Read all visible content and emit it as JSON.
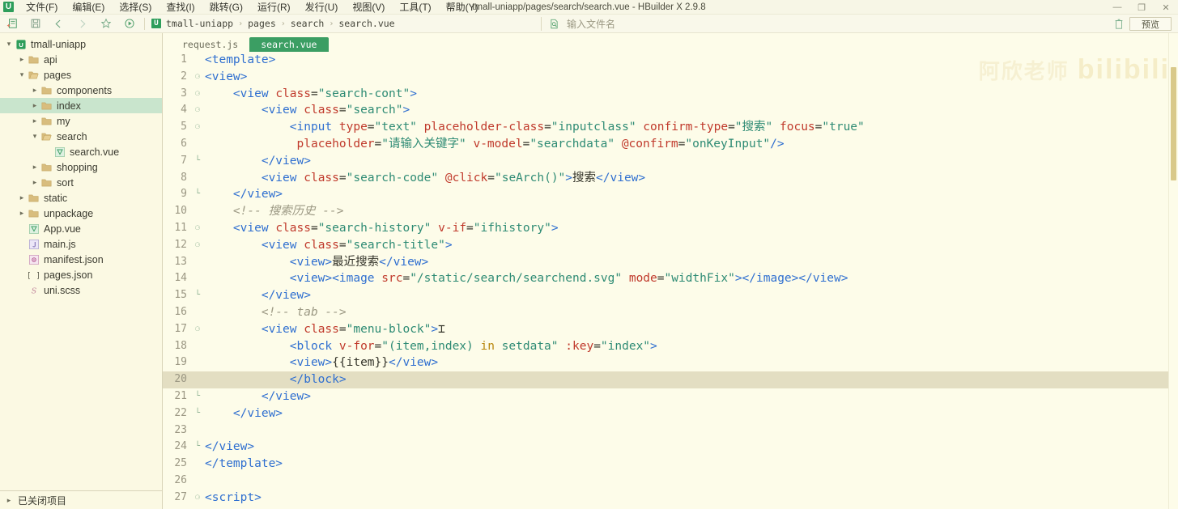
{
  "window": {
    "title": "tmall-uniapp/pages/search/search.vue - HBuilder X 2.9.8",
    "logo": "U",
    "minimize_label": "—",
    "restore_label": "❐",
    "close_label": "✕"
  },
  "menubar": {
    "items": [
      {
        "label": "文件(F)",
        "name": "menu-file"
      },
      {
        "label": "编辑(E)",
        "name": "menu-edit"
      },
      {
        "label": "选择(S)",
        "name": "menu-select"
      },
      {
        "label": "查找(I)",
        "name": "menu-find"
      },
      {
        "label": "跳转(G)",
        "name": "menu-goto"
      },
      {
        "label": "运行(R)",
        "name": "menu-run"
      },
      {
        "label": "发行(U)",
        "name": "menu-publish"
      },
      {
        "label": "视图(V)",
        "name": "menu-view"
      },
      {
        "label": "工具(T)",
        "name": "menu-tools"
      },
      {
        "label": "帮助(Y)",
        "name": "menu-help"
      }
    ]
  },
  "toolbar": {
    "icons": [
      {
        "name": "new-file-icon"
      },
      {
        "name": "save-icon"
      },
      {
        "name": "back-arrow-icon"
      },
      {
        "name": "forward-arrow-icon"
      },
      {
        "name": "favorite-star-icon"
      },
      {
        "name": "run-play-icon"
      }
    ],
    "breadcrumb_logo": "U",
    "breadcrumb": [
      "tmall-uniapp",
      "pages",
      "search",
      "search.vue"
    ],
    "breadcrumb_separator": "›",
    "filename_placeholder": "输入文件名",
    "preview_label": "预览"
  },
  "sidebar": {
    "tree": [
      {
        "label": "tmall-uniapp",
        "indent": 0,
        "twisty": "down",
        "icon": "project-icon",
        "selected": false
      },
      {
        "label": "api",
        "indent": 1,
        "twisty": "right",
        "icon": "folder-icon",
        "selected": false
      },
      {
        "label": "pages",
        "indent": 1,
        "twisty": "down",
        "icon": "folder-open-icon",
        "selected": false
      },
      {
        "label": "components",
        "indent": 2,
        "twisty": "right",
        "icon": "folder-icon",
        "selected": false
      },
      {
        "label": "index",
        "indent": 2,
        "twisty": "right",
        "icon": "folder-icon",
        "selected": true
      },
      {
        "label": "my",
        "indent": 2,
        "twisty": "right",
        "icon": "folder-icon",
        "selected": false
      },
      {
        "label": "search",
        "indent": 2,
        "twisty": "down",
        "icon": "folder-open-icon",
        "selected": false
      },
      {
        "label": "search.vue",
        "indent": 3,
        "twisty": "none",
        "icon": "vue-file-icon",
        "selected": false
      },
      {
        "label": "shopping",
        "indent": 2,
        "twisty": "right",
        "icon": "folder-icon",
        "selected": false
      },
      {
        "label": "sort",
        "indent": 2,
        "twisty": "right",
        "icon": "folder-icon",
        "selected": false
      },
      {
        "label": "static",
        "indent": 1,
        "twisty": "right",
        "icon": "folder-icon",
        "selected": false
      },
      {
        "label": "unpackage",
        "indent": 1,
        "twisty": "right",
        "icon": "folder-icon",
        "selected": false
      },
      {
        "label": "App.vue",
        "indent": 1,
        "twisty": "none",
        "icon": "vue-file-icon",
        "selected": false
      },
      {
        "label": "main.js",
        "indent": 1,
        "twisty": "none",
        "icon": "js-file-icon",
        "selected": false
      },
      {
        "label": "manifest.json",
        "indent": 1,
        "twisty": "none",
        "icon": "json-file-icon",
        "selected": false
      },
      {
        "label": "pages.json",
        "indent": 1,
        "twisty": "none",
        "icon": "brackets-file-icon",
        "selected": false
      },
      {
        "label": "uni.scss",
        "indent": 1,
        "twisty": "none",
        "icon": "scss-file-icon",
        "selected": false
      }
    ],
    "closed_projects_label": "已关闭项目"
  },
  "editor": {
    "tabs": [
      {
        "label": "request.js",
        "active": false
      },
      {
        "label": "search.vue",
        "active": true
      }
    ],
    "watermark_cn": "阿欣老师",
    "watermark_en": "bilibili",
    "active_line": 20,
    "lines": [
      {
        "n": 1,
        "fold": "",
        "indent": 0,
        "tokens": [
          {
            "c": "t-tag",
            "t": "<template>"
          }
        ]
      },
      {
        "n": 2,
        "fold": "-",
        "indent": 0,
        "tokens": [
          {
            "c": "t-tag",
            "t": "<view>"
          }
        ]
      },
      {
        "n": 3,
        "fold": "-",
        "indent": 1,
        "tokens": [
          {
            "c": "t-tag",
            "t": "<view "
          },
          {
            "c": "t-attr",
            "t": "class"
          },
          {
            "c": "t-plain",
            "t": "="
          },
          {
            "c": "t-str",
            "t": "\"search-cont\""
          },
          {
            "c": "t-tag",
            "t": ">"
          }
        ]
      },
      {
        "n": 4,
        "fold": "-",
        "indent": 2,
        "tokens": [
          {
            "c": "t-tag",
            "t": "<view "
          },
          {
            "c": "t-attr",
            "t": "class"
          },
          {
            "c": "t-plain",
            "t": "="
          },
          {
            "c": "t-str",
            "t": "\"search\""
          },
          {
            "c": "t-tag",
            "t": ">"
          }
        ]
      },
      {
        "n": 5,
        "fold": "-",
        "indent": 3,
        "tokens": [
          {
            "c": "t-tag",
            "t": "<input "
          },
          {
            "c": "t-attr",
            "t": "type"
          },
          {
            "c": "t-plain",
            "t": "="
          },
          {
            "c": "t-str",
            "t": "\"text\""
          },
          {
            "c": "t-plain",
            "t": " "
          },
          {
            "c": "t-attr",
            "t": "placeholder-class"
          },
          {
            "c": "t-plain",
            "t": "="
          },
          {
            "c": "t-str",
            "t": "\"inputclass\""
          },
          {
            "c": "t-plain",
            "t": " "
          },
          {
            "c": "t-attr",
            "t": "confirm-type"
          },
          {
            "c": "t-plain",
            "t": "="
          },
          {
            "c": "t-str",
            "t": "\"搜索\""
          },
          {
            "c": "t-plain",
            "t": " "
          },
          {
            "c": "t-attr",
            "t": "focus"
          },
          {
            "c": "t-plain",
            "t": "="
          },
          {
            "c": "t-str",
            "t": "\"true\""
          }
        ]
      },
      {
        "n": 6,
        "fold": "",
        "indent": 3,
        "tokens": [
          {
            "c": "t-plain",
            "t": " "
          },
          {
            "c": "t-attr",
            "t": "placeholder"
          },
          {
            "c": "t-plain",
            "t": "="
          },
          {
            "c": "t-str",
            "t": "\"请输入关键字\""
          },
          {
            "c": "t-plain",
            "t": " "
          },
          {
            "c": "t-attr",
            "t": "v-model"
          },
          {
            "c": "t-plain",
            "t": "="
          },
          {
            "c": "t-str",
            "t": "\"searchdata\""
          },
          {
            "c": "t-plain",
            "t": " "
          },
          {
            "c": "t-attr",
            "t": "@confirm"
          },
          {
            "c": "t-plain",
            "t": "="
          },
          {
            "c": "t-str",
            "t": "\"onKeyInput\""
          },
          {
            "c": "t-tag",
            "t": "/>"
          }
        ]
      },
      {
        "n": 7,
        "fold": "|",
        "indent": 2,
        "tokens": [
          {
            "c": "t-tag",
            "t": "</view>"
          }
        ]
      },
      {
        "n": 8,
        "fold": "",
        "indent": 2,
        "tokens": [
          {
            "c": "t-tag",
            "t": "<view "
          },
          {
            "c": "t-attr",
            "t": "class"
          },
          {
            "c": "t-plain",
            "t": "="
          },
          {
            "c": "t-str",
            "t": "\"search-code\""
          },
          {
            "c": "t-plain",
            "t": " "
          },
          {
            "c": "t-attr",
            "t": "@click"
          },
          {
            "c": "t-plain",
            "t": "="
          },
          {
            "c": "t-str",
            "t": "\"seArch()\""
          },
          {
            "c": "t-tag",
            "t": ">"
          },
          {
            "c": "t-plain",
            "t": "搜索"
          },
          {
            "c": "t-tag",
            "t": "</view>"
          }
        ]
      },
      {
        "n": 9,
        "fold": "|",
        "indent": 1,
        "tokens": [
          {
            "c": "t-tag",
            "t": "</view>"
          }
        ]
      },
      {
        "n": 10,
        "fold": "",
        "indent": 1,
        "tokens": [
          {
            "c": "t-comm",
            "t": "<!-- 搜索历史 -->"
          }
        ]
      },
      {
        "n": 11,
        "fold": "-",
        "indent": 1,
        "tokens": [
          {
            "c": "t-tag",
            "t": "<view "
          },
          {
            "c": "t-attr",
            "t": "class"
          },
          {
            "c": "t-plain",
            "t": "="
          },
          {
            "c": "t-str",
            "t": "\"search-history\""
          },
          {
            "c": "t-plain",
            "t": " "
          },
          {
            "c": "t-attr",
            "t": "v-if"
          },
          {
            "c": "t-plain",
            "t": "="
          },
          {
            "c": "t-str",
            "t": "\"ifhistory\""
          },
          {
            "c": "t-tag",
            "t": ">"
          }
        ]
      },
      {
        "n": 12,
        "fold": "-",
        "indent": 2,
        "tokens": [
          {
            "c": "t-tag",
            "t": "<view "
          },
          {
            "c": "t-attr",
            "t": "class"
          },
          {
            "c": "t-plain",
            "t": "="
          },
          {
            "c": "t-str",
            "t": "\"search-title\""
          },
          {
            "c": "t-tag",
            "t": ">"
          }
        ]
      },
      {
        "n": 13,
        "fold": "",
        "indent": 3,
        "tokens": [
          {
            "c": "t-tag",
            "t": "<view>"
          },
          {
            "c": "t-plain",
            "t": "最近搜索"
          },
          {
            "c": "t-tag",
            "t": "</view>"
          }
        ]
      },
      {
        "n": 14,
        "fold": "",
        "indent": 3,
        "tokens": [
          {
            "c": "t-tag",
            "t": "<view><image "
          },
          {
            "c": "t-attr",
            "t": "src"
          },
          {
            "c": "t-plain",
            "t": "="
          },
          {
            "c": "t-str",
            "t": "\"/static/search/searchend.svg\""
          },
          {
            "c": "t-plain",
            "t": " "
          },
          {
            "c": "t-attr",
            "t": "mode"
          },
          {
            "c": "t-plain",
            "t": "="
          },
          {
            "c": "t-str",
            "t": "\"widthFix\""
          },
          {
            "c": "t-tag",
            "t": "></image></view>"
          }
        ]
      },
      {
        "n": 15,
        "fold": "|",
        "indent": 2,
        "tokens": [
          {
            "c": "t-tag",
            "t": "</view>"
          }
        ]
      },
      {
        "n": 16,
        "fold": "",
        "indent": 2,
        "tokens": [
          {
            "c": "t-comm",
            "t": "<!-- tab -->"
          }
        ]
      },
      {
        "n": 17,
        "fold": "-",
        "indent": 2,
        "tokens": [
          {
            "c": "t-tag",
            "t": "<view "
          },
          {
            "c": "t-attr",
            "t": "class"
          },
          {
            "c": "t-plain",
            "t": "="
          },
          {
            "c": "t-str",
            "t": "\"menu-block\""
          },
          {
            "c": "t-tag",
            "t": ">"
          },
          {
            "c": "ibeam",
            "t": "⌶"
          }
        ]
      },
      {
        "n": 18,
        "fold": "",
        "indent": 3,
        "tokens": [
          {
            "c": "t-tag",
            "t": "<block "
          },
          {
            "c": "t-attr",
            "t": "v-for"
          },
          {
            "c": "t-plain",
            "t": "="
          },
          {
            "c": "t-str",
            "t": "\"(item,index) "
          },
          {
            "c": "t-kw",
            "t": "in"
          },
          {
            "c": "t-str",
            "t": " setdata\""
          },
          {
            "c": "t-plain",
            "t": " "
          },
          {
            "c": "t-attr",
            "t": ":key"
          },
          {
            "c": "t-plain",
            "t": "="
          },
          {
            "c": "t-str",
            "t": "\"index\""
          },
          {
            "c": "t-tag",
            "t": ">"
          }
        ]
      },
      {
        "n": 19,
        "fold": "",
        "indent": 3,
        "tokens": [
          {
            "c": "t-tag",
            "t": "<view>"
          },
          {
            "c": "t-mus",
            "t": "{{item}}"
          },
          {
            "c": "t-tag",
            "t": "</view>"
          }
        ]
      },
      {
        "n": 20,
        "fold": "",
        "indent": 3,
        "tokens": [
          {
            "c": "t-tag",
            "t": "</block>"
          }
        ]
      },
      {
        "n": 21,
        "fold": "|",
        "indent": 2,
        "tokens": [
          {
            "c": "t-tag",
            "t": "</view>"
          }
        ]
      },
      {
        "n": 22,
        "fold": "|",
        "indent": 1,
        "tokens": [
          {
            "c": "t-tag",
            "t": "</view>"
          }
        ]
      },
      {
        "n": 23,
        "fold": "",
        "indent": 0,
        "tokens": []
      },
      {
        "n": 24,
        "fold": "|",
        "indent": 0,
        "tokens": [
          {
            "c": "t-tag",
            "t": "</view>"
          }
        ]
      },
      {
        "n": 25,
        "fold": "",
        "indent": 0,
        "tokens": [
          {
            "c": "t-tag",
            "t": "</template>"
          }
        ]
      },
      {
        "n": 26,
        "fold": "",
        "indent": 0,
        "tokens": []
      },
      {
        "n": 27,
        "fold": "-",
        "indent": 0,
        "tokens": [
          {
            "c": "t-tag",
            "t": "<script>"
          }
        ]
      }
    ]
  },
  "colors": {
    "accent_green": "#3b9e63",
    "selection_green": "#c9e5cd",
    "editor_bg": "#fdfce9",
    "sidebar_bg": "#fbf9e3",
    "highlight_line": "#e3dec2",
    "tag_blue": "#2f6fd0",
    "attr_red": "#c0392b",
    "string_teal": "#2e8b74",
    "comment_gray": "#9b9883"
  }
}
